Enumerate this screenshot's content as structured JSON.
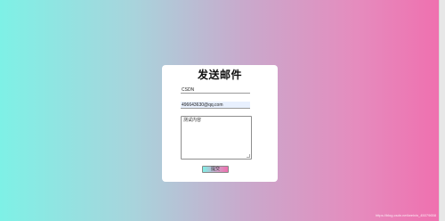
{
  "form": {
    "title": "发送邮件",
    "name_value": "CSDN",
    "email_value": "496643630@qq.com",
    "content_value": "测试内容",
    "submit_label": "提交"
  },
  "watermark": "https://blog.csdn.net/weixin_45079658",
  "colors": {
    "gradient_start": "#7ef1e6",
    "gradient_mid": "#c9a9cc",
    "gradient_end": "#f06eae",
    "card_background": "#ffffff",
    "autofill_background": "#e8f0fe"
  }
}
